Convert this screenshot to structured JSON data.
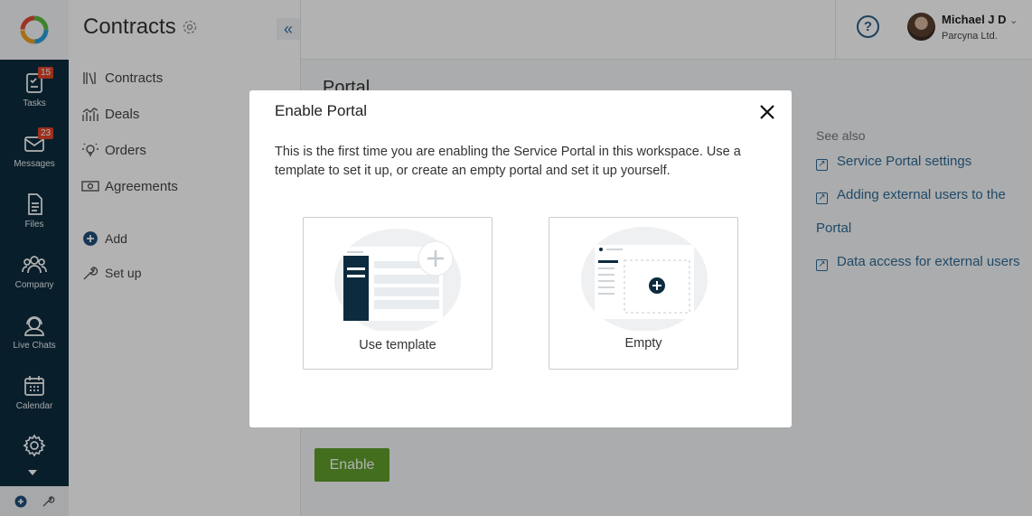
{
  "rail": {
    "items": [
      {
        "label": "Tasks",
        "icon": "tasks-icon",
        "badge": "15"
      },
      {
        "label": "Messages",
        "icon": "messages-icon",
        "badge": "23"
      },
      {
        "label": "Files",
        "icon": "files-icon"
      },
      {
        "label": "Company",
        "icon": "company-icon"
      },
      {
        "label": "Live Chats",
        "icon": "live-chats-icon"
      },
      {
        "label": "Calendar",
        "icon": "calendar-icon"
      },
      {
        "label": "",
        "icon": "settings-gear-icon"
      }
    ]
  },
  "sidebar": {
    "title": "Contracts",
    "items": [
      {
        "label": "Contracts",
        "icon": "books-icon"
      },
      {
        "label": "Deals",
        "icon": "chart-bars-icon"
      },
      {
        "label": "Orders",
        "icon": "lightbulb-icon"
      },
      {
        "label": "Agreements",
        "icon": "banknote-icon"
      }
    ],
    "add_label": "Add",
    "setup_label": "Set up"
  },
  "header": {
    "user_name": "Michael J D",
    "company": "Parcyna Ltd."
  },
  "main": {
    "title": "Portal",
    "see_also": "See also",
    "links": [
      "Service Portal settings",
      "Adding external users to the",
      "Portal",
      "Data access for external users"
    ],
    "enable_label": "Enable"
  },
  "modal": {
    "title": "Enable Portal",
    "description": "This is the first time you are enabling the Service Portal in this workspace. Use a template to set it up, or create an empty portal and set it up yourself.",
    "options": [
      {
        "label": "Use template"
      },
      {
        "label": "Empty"
      }
    ]
  },
  "colors": {
    "rail": "#0d2b3e",
    "accent_link": "#2e6b96",
    "enable_button": "#5f9e2c",
    "badge": "#e0442a"
  }
}
